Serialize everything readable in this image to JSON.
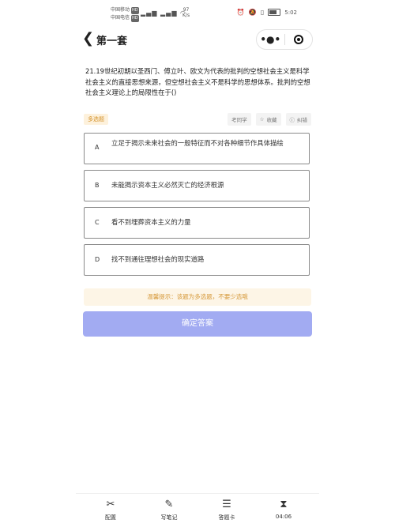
{
  "status_bar": {
    "carrier1": "中国移动",
    "carrier1_badge": "HD",
    "carrier2": "中国电信",
    "carrier2_badge": "HD",
    "network_speed_value": "97",
    "network_speed_unit": "K/s",
    "time": "5:02"
  },
  "nav": {
    "title": "第一套"
  },
  "question": {
    "text": "21.19世纪初期以圣西门、傅立叶、欧文为代表的批判的空想社会主义是科学社会主义的直接思想来源，但空想社会主义不是科学的思想体系。批判的空想社会主义理论上的局限性在于()",
    "type_tag": "多选题",
    "actions": {
      "ask": "考同学",
      "favorite": "收藏",
      "report": "纠错"
    }
  },
  "options": [
    {
      "letter": "A",
      "text": "立足于揭示未来社会的一般特征而不对各种细节作具体描绘"
    },
    {
      "letter": "B",
      "text": "未能揭示资本主义必然灭亡的经济根源"
    },
    {
      "letter": "C",
      "text": "看不到埋葬资本主义的力量"
    },
    {
      "letter": "D",
      "text": "找不到通往理想社会的现实道路"
    }
  ],
  "hint": "温馨提示：该题为多选题，不要少选哦",
  "confirm_label": "确定答案",
  "tabs": {
    "settings": "配置",
    "notes": "写笔记",
    "answer_card": "答题卡",
    "timer": "04:06"
  },
  "colors": {
    "confirm_bg": "#a2abf2",
    "tag_text": "#d4922a",
    "hint_bg": "#fdf5e6"
  }
}
